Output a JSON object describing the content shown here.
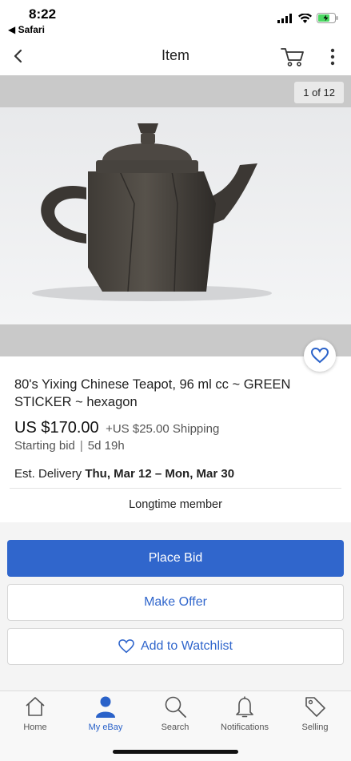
{
  "status_bar": {
    "time": "8:22",
    "back_app": "◀ Safari"
  },
  "nav": {
    "title": "Item",
    "back_icon": "chevron-left-icon",
    "cart_icon": "cart-icon",
    "more_icon": "more-vertical-icon"
  },
  "gallery": {
    "counter": "1 of 12"
  },
  "listing": {
    "title": "80's Yixing Chinese Teapot, 96 ml cc ~ GREEN STICKER ~ hexagon",
    "price": "US $170.00",
    "shipping": "+US $25.00 Shipping",
    "bid_type": "Starting bid",
    "separator": "|",
    "time_left": "5d 19h",
    "delivery_label": "Est. Delivery",
    "delivery_dates": "Thu, Mar 12 – Mon, Mar 30",
    "seller_badge": "Longtime member"
  },
  "actions": {
    "place_bid": "Place Bid",
    "make_offer": "Make Offer",
    "add_watchlist": "Add to Watchlist"
  },
  "tabs": [
    {
      "label": "Home",
      "icon": "home-icon",
      "active": false
    },
    {
      "label": "My eBay",
      "icon": "person-icon",
      "active": true
    },
    {
      "label": "Search",
      "icon": "search-icon",
      "active": false
    },
    {
      "label": "Notifications",
      "icon": "bell-icon",
      "active": false
    },
    {
      "label": "Selling",
      "icon": "tag-icon",
      "active": false
    }
  ],
  "colors": {
    "accent": "#3066cc",
    "active_tab": "#2a62c9",
    "battery": "#4cd964"
  }
}
